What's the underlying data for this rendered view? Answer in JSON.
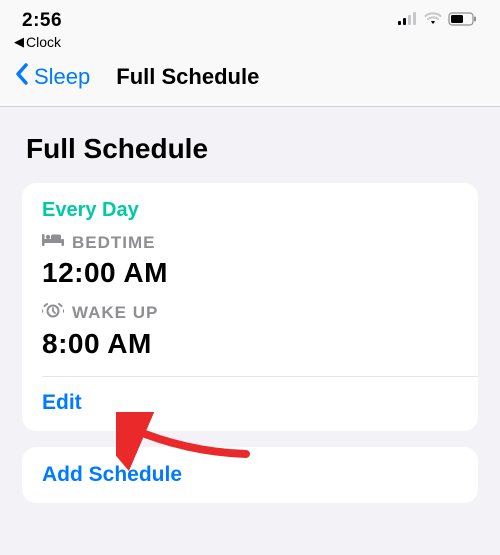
{
  "status": {
    "time": "2:56",
    "breadcrumb": "Clock"
  },
  "nav": {
    "back_label": "Sleep",
    "title": "Full Schedule"
  },
  "page": {
    "heading": "Full Schedule"
  },
  "schedule": {
    "frequency": "Every Day",
    "bedtime_label": "BEDTIME",
    "bedtime_value": "12:00 AM",
    "wakeup_label": "WAKE UP",
    "wakeup_value": "8:00 AM",
    "edit_label": "Edit"
  },
  "actions": {
    "add_label": "Add Schedule"
  },
  "colors": {
    "accent_blue": "#007aff",
    "accent_teal": "#00c9a6",
    "muted": "#8e8e93",
    "background": "#f2f2f7",
    "arrow": "#ea2a2a"
  },
  "icons": {
    "bed": "bed-icon",
    "alarm": "alarm-icon",
    "signal": "signal-icon",
    "wifi": "wifi-icon",
    "battery": "battery-icon"
  }
}
